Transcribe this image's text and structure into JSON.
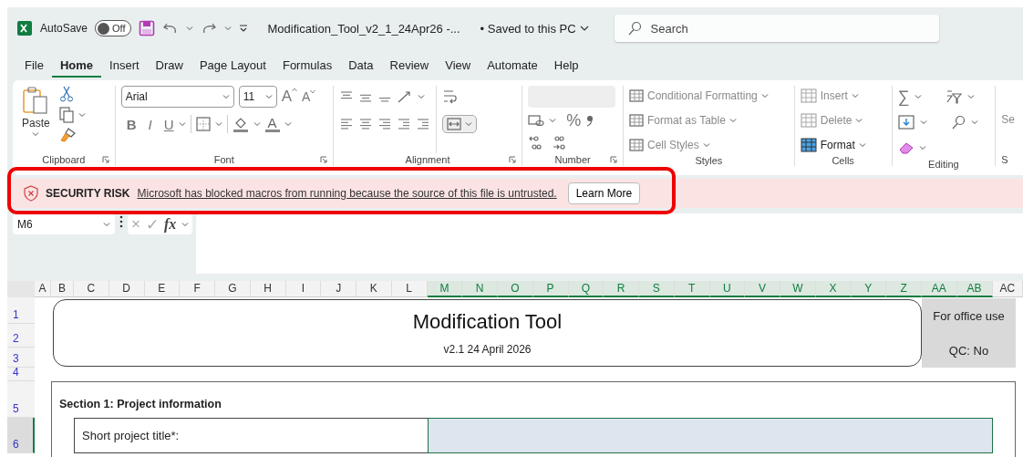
{
  "title_bar": {
    "autosave_label": "AutoSave",
    "autosave_toggle": {
      "label": "Off",
      "on": false
    },
    "file_name": "Modification_Tool_v2_1_24Apr26  -...",
    "save_status": "• Saved to this PC",
    "search": {
      "placeholder": "Search"
    }
  },
  "tabs": [
    {
      "label": "File",
      "selected": false
    },
    {
      "label": "Home",
      "selected": true
    },
    {
      "label": "Insert",
      "selected": false
    },
    {
      "label": "Draw",
      "selected": false
    },
    {
      "label": "Page Layout",
      "selected": false
    },
    {
      "label": "Formulas",
      "selected": false
    },
    {
      "label": "Data",
      "selected": false
    },
    {
      "label": "Review",
      "selected": false
    },
    {
      "label": "View",
      "selected": false
    },
    {
      "label": "Automate",
      "selected": false
    },
    {
      "label": "Help",
      "selected": false
    }
  ],
  "ribbon": {
    "clipboard": {
      "paste": "Paste",
      "label": "Clipboard"
    },
    "font": {
      "family": "Arial",
      "size": "11",
      "grow": "A",
      "shrink": "A",
      "bold": "B",
      "italic": "I",
      "underline": "U",
      "font_color": "A",
      "label": "Font"
    },
    "alignment": {
      "label": "Alignment"
    },
    "number": {
      "percent": "%",
      "label": "Number"
    },
    "styles": {
      "items": [
        {
          "label": "Conditional Formatting",
          "disabled": true
        },
        {
          "label": "Format as Table",
          "disabled": true
        },
        {
          "label": "Cell Styles",
          "disabled": true
        }
      ],
      "label": "Styles"
    },
    "cells": {
      "items": [
        {
          "label": "Insert",
          "disabled": true
        },
        {
          "label": "Delete",
          "disabled": true
        },
        {
          "label": "Format",
          "disabled": false
        }
      ],
      "label": "Cells"
    },
    "editing": {
      "sum": "∑",
      "label": "Editing"
    },
    "next_group": {
      "button": "Se",
      "label": "S"
    }
  },
  "message_bar": {
    "label": "SECURITY RISK",
    "message": "Microsoft has blocked macros from running because the source of this file is untrusted.",
    "button": "Learn More"
  },
  "formula_bar": {
    "name_box": "M6",
    "cancel": "×",
    "enter": "✓",
    "fx": "fx"
  },
  "sheet": {
    "columns": [
      {
        "label": "A",
        "selected": false
      },
      {
        "label": "B",
        "selected": false
      },
      {
        "label": "C",
        "selected": false
      },
      {
        "label": "D",
        "selected": false
      },
      {
        "label": "E",
        "selected": false
      },
      {
        "label": "F",
        "selected": false
      },
      {
        "label": "G",
        "selected": false
      },
      {
        "label": "H",
        "selected": false
      },
      {
        "label": "I",
        "selected": false
      },
      {
        "label": "J",
        "selected": false
      },
      {
        "label": "K",
        "selected": false
      },
      {
        "label": "L",
        "selected": false
      },
      {
        "label": "M",
        "selected": true
      },
      {
        "label": "N",
        "selected": true
      },
      {
        "label": "O",
        "selected": true
      },
      {
        "label": "P",
        "selected": true
      },
      {
        "label": "Q",
        "selected": true
      },
      {
        "label": "R",
        "selected": true
      },
      {
        "label": "S",
        "selected": true
      },
      {
        "label": "T",
        "selected": true
      },
      {
        "label": "U",
        "selected": true
      },
      {
        "label": "V",
        "selected": true
      },
      {
        "label": "W",
        "selected": true
      },
      {
        "label": "X",
        "selected": true
      },
      {
        "label": "Y",
        "selected": true
      },
      {
        "label": "Z",
        "selected": true
      },
      {
        "label": "AA",
        "selected": true
      },
      {
        "label": "AB",
        "selected": true
      },
      {
        "label": "AC",
        "selected": false
      }
    ],
    "rows": [
      {
        "label": "1",
        "selected": false
      },
      {
        "label": "2",
        "selected": false
      },
      {
        "label": "3",
        "selected": false
      },
      {
        "label": "4",
        "selected": false
      },
      {
        "label": "5",
        "selected": false
      },
      {
        "label": "6",
        "selected": true
      }
    ],
    "title": "Modification Tool",
    "version": "v2.1 24 April 2026",
    "office_use": {
      "heading": "For office use",
      "qc": "QC: No"
    },
    "section_title": "Section 1: Project information",
    "fields": [
      {
        "label": "Short project title*:",
        "selected": true
      }
    ]
  }
}
